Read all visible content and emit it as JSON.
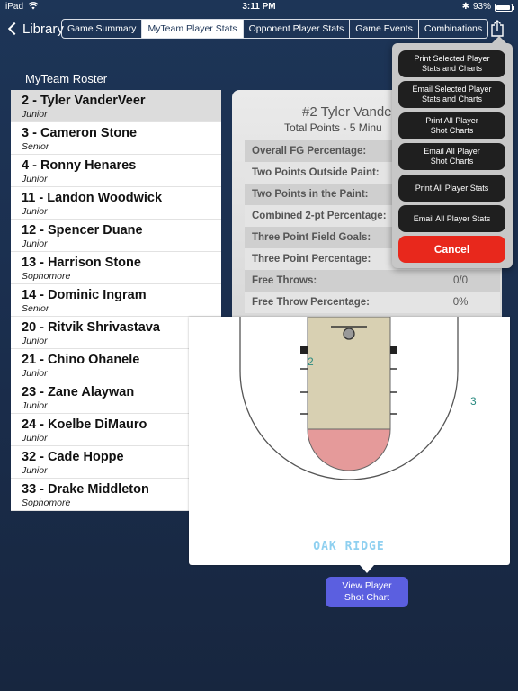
{
  "status": {
    "device": "iPad",
    "time": "3:11 PM",
    "battery": "93%",
    "battery_level": 0.93
  },
  "nav": {
    "back_label": "Library",
    "tabs": [
      {
        "label": "Game Summary",
        "active": false
      },
      {
        "label": "MyTeam Player Stats",
        "active": true
      },
      {
        "label": "Opponent Player Stats",
        "active": false
      },
      {
        "label": "Game Events",
        "active": false
      },
      {
        "label": "Combinations",
        "active": false
      }
    ]
  },
  "roster": {
    "title": "MyTeam Roster",
    "players": [
      {
        "name": "2 - Tyler VanderVeer",
        "year": "Junior",
        "selected": true
      },
      {
        "name": "3 - Cameron Stone",
        "year": "Senior"
      },
      {
        "name": "4 - Ronny Henares",
        "year": "Junior"
      },
      {
        "name": "11 - Landon Woodwick",
        "year": "Junior"
      },
      {
        "name": "12 - Spencer Duane",
        "year": "Junior"
      },
      {
        "name": "13 - Harrison Stone",
        "year": "Sophomore"
      },
      {
        "name": "14 - Dominic Ingram",
        "year": "Senior"
      },
      {
        "name": "20 - Ritvik Shrivastava",
        "year": "Junior"
      },
      {
        "name": "21 - Chino Ohanele",
        "year": "Junior"
      },
      {
        "name": "23 - Zane Alaywan",
        "year": "Junior"
      },
      {
        "name": "24 - Koelbe DiMauro",
        "year": "Junior"
      },
      {
        "name": "32 - Cade Hoppe",
        "year": "Junior"
      },
      {
        "name": "33 - Drake Middleton",
        "year": "Sophomore"
      }
    ]
  },
  "stats": {
    "player_title": "#2  Tyler Vande",
    "subtitle": "Total Points - 5   Minu",
    "rows": [
      {
        "label": "Overall FG Percentage:",
        "value": ""
      },
      {
        "label": "Two Points Outside Paint:",
        "value": ""
      },
      {
        "label": "Two Points in the Paint:",
        "value": ""
      },
      {
        "label": "Combined 2-pt Percentage:",
        "value": ""
      },
      {
        "label": "Three Point Field Goals:",
        "value": ""
      },
      {
        "label": "Three Point Percentage:",
        "value": ""
      },
      {
        "label": "Free Throws:",
        "value": "0/0"
      },
      {
        "label": "Free Throw Percentage:",
        "value": "0%"
      }
    ]
  },
  "court": {
    "zone_labels": [
      "2",
      "3"
    ],
    "court_name": "OAK RIDGE",
    "paint_color": "#d8d0b2",
    "circle_color": "#e59a9a",
    "name_color": "#8fd0f0"
  },
  "view_chart_label": "View Player\nShot Chart",
  "menu": {
    "items": [
      "Print Selected Player\nStats and Charts",
      "Email Selected Player\nStats and Charts",
      "Print All Player\nShot Charts",
      "Email All Player\nShot Charts",
      "Print All Player Stats",
      "Email All Player Stats"
    ],
    "cancel_label": "Cancel"
  }
}
